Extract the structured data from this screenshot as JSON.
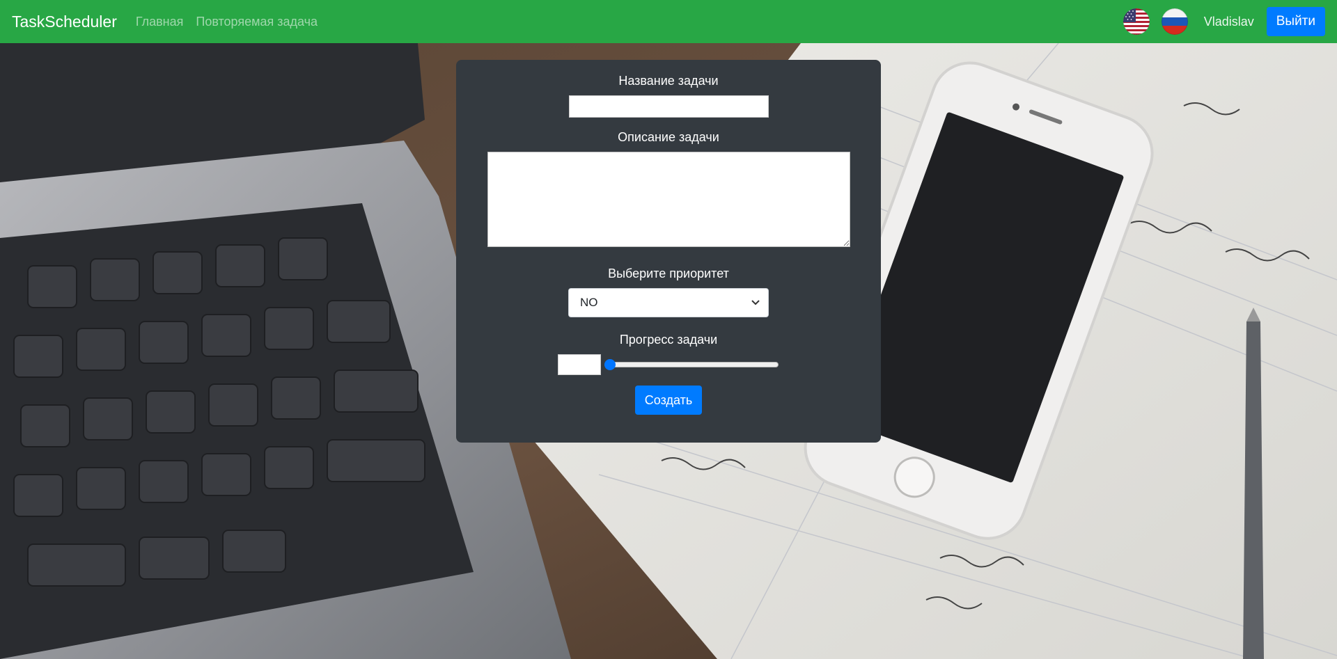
{
  "navbar": {
    "brand": "TaskScheduler",
    "links": [
      "Главная",
      "Повторяемая задача"
    ],
    "languages": [
      {
        "icon": "us-flag-icon"
      },
      {
        "icon": "ru-flag-icon"
      }
    ],
    "username": "Vladislav",
    "logout_label": "Выйти",
    "color": "#28a745"
  },
  "form": {
    "name_label": "Название задачи",
    "name_value": "",
    "description_label": "Описание задачи",
    "description_value": "",
    "priority_label": "Выберите приоритет",
    "priority_selected": "NO",
    "progress_label": "Прогресс задачи",
    "progress_value": "",
    "progress_slider": 0,
    "submit_label": "Создать",
    "card_color": "#343a40",
    "button_color": "#007bff"
  }
}
